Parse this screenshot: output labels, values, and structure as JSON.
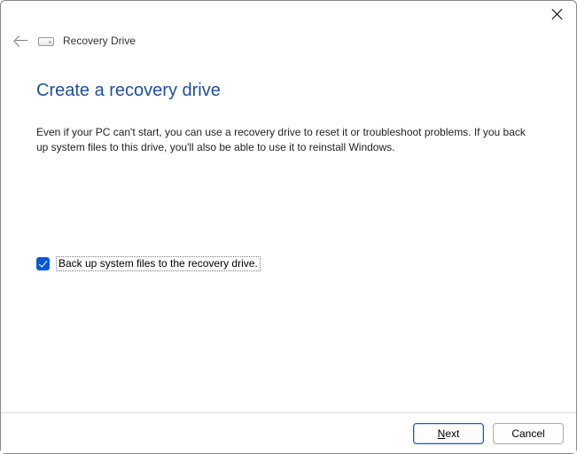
{
  "window": {
    "title": "Recovery Drive"
  },
  "heading": "Create a recovery drive",
  "description": "Even if your PC can't start, you can use a recovery drive to reset it or troubleshoot problems. If you back up system files to this drive, you'll also be able to use it to reinstall Windows.",
  "checkbox": {
    "checked": true,
    "label": "Back up system files to the recovery drive."
  },
  "buttons": {
    "next_prefix": "N",
    "next_rest": "ext",
    "cancel": "Cancel"
  }
}
